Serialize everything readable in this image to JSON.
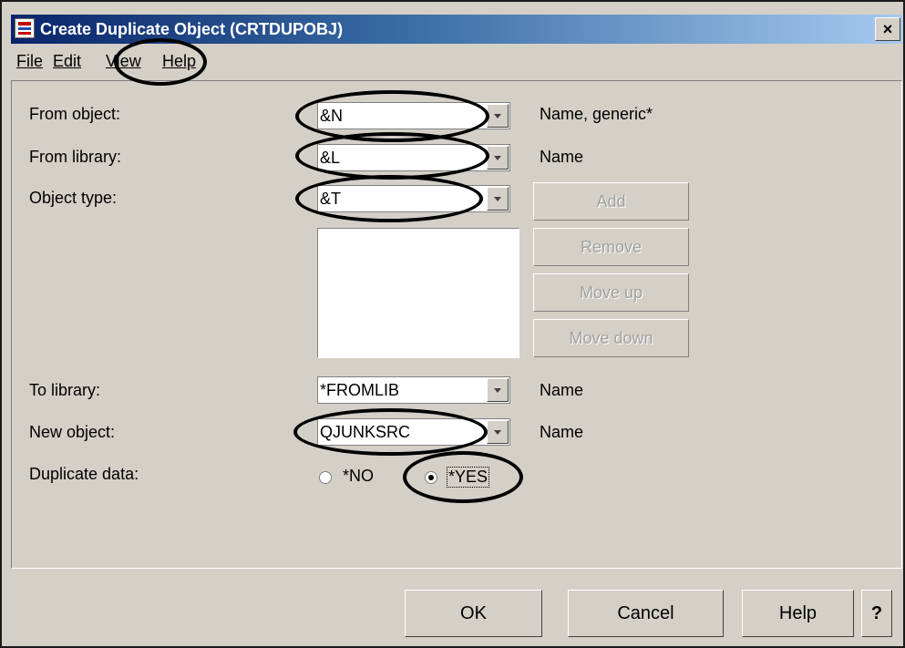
{
  "window": {
    "title": "Create Duplicate Object (CRTDUPOBJ)",
    "close_label": "×"
  },
  "menubar": {
    "items": [
      {
        "label": "File"
      },
      {
        "label": "Edit"
      },
      {
        "label": "View"
      },
      {
        "label": "Help"
      }
    ]
  },
  "form": {
    "from_object": {
      "label": "From object:",
      "value": "&N",
      "hint": "Name, generic*"
    },
    "from_library": {
      "label": "From library:",
      "value": "&L",
      "hint": "Name"
    },
    "object_type": {
      "label": "Object type:",
      "value": "&T"
    },
    "list_buttons": {
      "add": "Add",
      "remove": "Remove",
      "move_up": "Move up",
      "move_down": "Move down"
    },
    "to_library": {
      "label": "To library:",
      "value": "*FROMLIB",
      "hint": "Name"
    },
    "new_object": {
      "label": "New object:",
      "value": "QJUNKSRC",
      "hint": "Name"
    },
    "duplicate_data": {
      "label": "Duplicate data:",
      "options": [
        "*NO",
        "*YES"
      ],
      "selected": "*YES"
    }
  },
  "footer": {
    "ok": "OK",
    "cancel": "Cancel",
    "help": "Help",
    "whats_this": "?"
  },
  "colors": {
    "window_bg": "#d4d0c8",
    "titlebar_start": "#0a246a",
    "titlebar_end": "#a6caf0",
    "disabled_text": "#a0a0a0",
    "annotation": "#000000"
  }
}
